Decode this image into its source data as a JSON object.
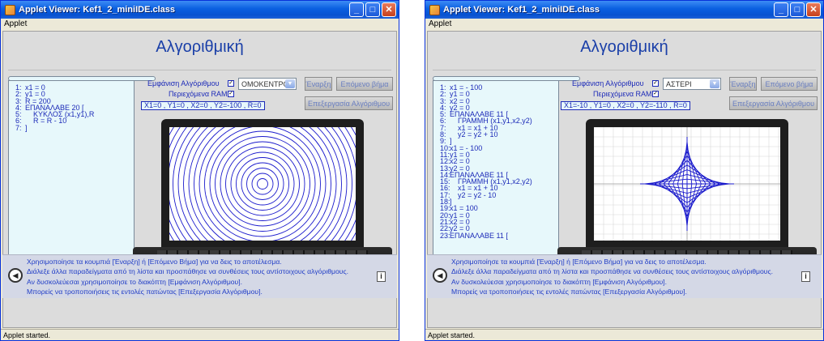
{
  "windows": [
    {
      "title": "Applet Viewer: Kef1_2_miniIDE.class",
      "menu": "Applet",
      "heading": "Αλγοριθμική",
      "controls": {
        "show_algorithm_label": "Εμφάνιση Αλγόριθμου",
        "ram_label": "Περιεχόμενα RAM",
        "select_value": "ΟΜΟΚΕΝΤΡΟ",
        "start_button": "Έναρξη",
        "next_step_button": "Επόμενο βήμα",
        "edit_button": "Επεξεργασία Αλγόριθμου",
        "ram_values": "X1=0 , Y1=0 , X2=0 , Y2=-100 , R=0"
      },
      "code_lines": [
        {
          "n": "1:",
          "t": "x1 = 0"
        },
        {
          "n": "2:",
          "t": "y1 = 0"
        },
        {
          "n": "3:",
          "t": "R = 200"
        },
        {
          "n": "4:",
          "t": "ΕΠΑΝΑΛΑΒΕ 20 ["
        },
        {
          "n": "5:",
          "t": "    ΚΥΚΛΟΣ (x1,y1),R"
        },
        {
          "n": "6:",
          "t": "    R = R - 10"
        },
        {
          "n": "7:",
          "t": "]"
        }
      ],
      "status": "Applet started."
    },
    {
      "title": "Applet Viewer: Kef1_2_miniIDE.class",
      "menu": "Applet",
      "heading": "Αλγοριθμική",
      "controls": {
        "show_algorithm_label": "Εμφάνιση Αλγόριθμου",
        "ram_label": "Περιεχόμενα RAM",
        "select_value": "ΑΣΤΕΡΙ",
        "start_button": "Έναρξη",
        "next_step_button": "Επόμενο βήμα",
        "edit_button": "Επεξεργασία Αλγόριθμου",
        "ram_values": "X1=-10 , Y1=0 , X2=0 , Y2=-110 , R=0"
      },
      "code_lines": [
        {
          "n": "1:",
          "t": "x1 = - 100"
        },
        {
          "n": "2:",
          "t": "y1 = 0"
        },
        {
          "n": "3:",
          "t": "x2 = 0"
        },
        {
          "n": "4:",
          "t": "y2 = 0"
        },
        {
          "n": "5:",
          "t": "ΕΠΑΝΑΛΑΒΕ 11 ["
        },
        {
          "n": "6:",
          "t": "    ΓΡΑΜΜΗ (x1,y1,x2,y2)"
        },
        {
          "n": "7:",
          "t": "    x1 = x1 + 10"
        },
        {
          "n": "8:",
          "t": "    y2 = y2 + 10"
        },
        {
          "n": "9:",
          "t": "]"
        },
        {
          "n": "10:",
          "t": "x1 = - 100"
        },
        {
          "n": "11:",
          "t": "y1 = 0"
        },
        {
          "n": "12:",
          "t": "x2 = 0"
        },
        {
          "n": "13:",
          "t": "y2 = 0"
        },
        {
          "n": "14:",
          "t": "ΕΠΑΝΑΛΑΒΕ 11 ["
        },
        {
          "n": "15:",
          "t": "    ΓΡΑΜΜΗ (x1,y1,x2,y2)"
        },
        {
          "n": "16:",
          "t": "    x1 = x1 + 10"
        },
        {
          "n": "17:",
          "t": "    y2 = y2 - 10"
        },
        {
          "n": "18:",
          "t": "]"
        },
        {
          "n": "19:",
          "t": "x1 = 100"
        },
        {
          "n": "20:",
          "t": "y1 = 0"
        },
        {
          "n": "21:",
          "t": "x2 = 0"
        },
        {
          "n": "22:",
          "t": "y2 = 0"
        },
        {
          "n": "23:",
          "t": "ΕΠΑΝΑΛΑΒΕ 11 ["
        }
      ],
      "status": "Applet started."
    }
  ],
  "help_lines": [
    "Χρησιμοποίησε τα κουμπιά [Έναρξη] ή [Επόμενο Βήμα] για να δεις το αποτέλεσμα.",
    "Διάλεξε άλλα παραδείγματα από τη λίστα και προσπάθησε να συνθέσεις τους αντίστοιχους αλγόριθμους.",
    "Αν δυσκολεύεσαι χρησιμοποίησε το διακόπτη [Εμφάνιση Αλγόριθμου].",
    "Μπορείς να τροποποιήσεις τις εντολές πατώντας [Επεξεργασία Αλγόριθμου]."
  ],
  "colors": {
    "accent": "#1c2ab8",
    "drawing": "#1a1acc",
    "panel": "#dcdcdc"
  }
}
